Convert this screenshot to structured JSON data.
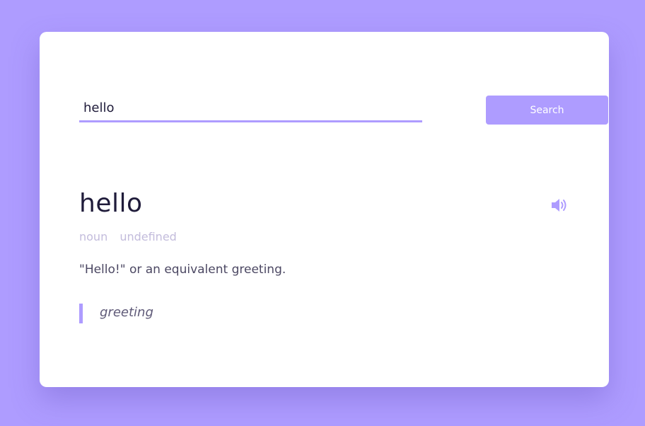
{
  "search": {
    "value": "hello",
    "button_label": "Search"
  },
  "entry": {
    "word": "hello",
    "part_of_speech": "noun",
    "phonetic": "undefined",
    "definition": "\"Hello!\" or an equivalent greeting.",
    "example": "greeting"
  },
  "icons": {
    "speaker": "speaker-icon"
  },
  "colors": {
    "background": "#ae9cff",
    "accent": "#ae9cff",
    "card": "#ffffff",
    "title_text": "#1f1b3a",
    "muted_text": "#c3bcdc"
  }
}
